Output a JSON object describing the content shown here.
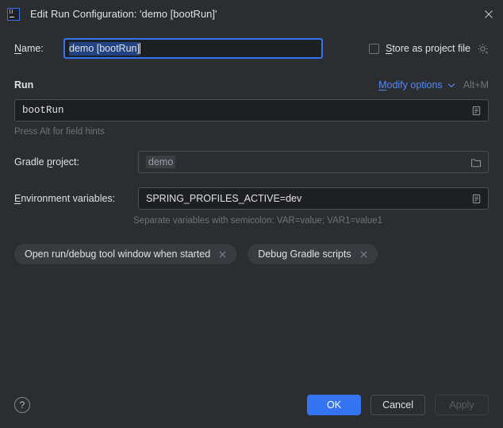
{
  "window": {
    "icon": "intellij-idea-icon",
    "title": "Edit Run Configuration: 'demo [bootRun]'",
    "close_icon": "close-icon"
  },
  "name_row": {
    "label": "Name:",
    "label_mnemonic": "N",
    "label_rest": "ame:",
    "value": "demo [bootRun]",
    "store_checkbox_label": "Store as project file",
    "store_mnemonic": "S",
    "store_rest": "tore as project file",
    "store_checked": false,
    "gear_icon": "gear-icon"
  },
  "run_section": {
    "title": "Run",
    "modify_options_label": "Modify options",
    "modify_mnemonic": "M",
    "modify_rest": "odify options",
    "modify_shortcut": "Alt+M",
    "chevron_icon": "chevron-down-icon",
    "task_value": "bootRun",
    "task_expand_icon": "expand-editor-icon",
    "hint": "Press Alt for field hints"
  },
  "gradle_project": {
    "label": "Gradle project:",
    "label_pre": "Gradle ",
    "label_mnemonic": "p",
    "label_rest": "roject:",
    "value": "demo",
    "browse_icon": "folder-icon"
  },
  "environment_variables": {
    "label": "Environment variables:",
    "label_mnemonic": "E",
    "label_rest": "nvironment variables:",
    "value": "SPRING_PROFILES_ACTIVE=dev",
    "expand_icon": "expand-editor-icon",
    "hint": "Separate variables with semicolon: VAR=value; VAR1=value1"
  },
  "option_chips": [
    {
      "label": "Open run/debug tool window when started",
      "remove_icon": "close-icon"
    },
    {
      "label": "Debug Gradle scripts",
      "remove_icon": "close-icon"
    }
  ],
  "footer": {
    "help_label": "?",
    "ok_label": "OK",
    "cancel_label": "Cancel",
    "apply_label": "Apply",
    "apply_disabled": true
  },
  "colors": {
    "dialog_background": "#2b2d30",
    "input_background": "#1e1f22",
    "accent_blue": "#3574f0",
    "link_blue": "#548af7",
    "selection_blue": "#214283",
    "text_primary": "#dfe1e5",
    "text_muted": "#6f737a",
    "chip_background": "#393b40"
  }
}
